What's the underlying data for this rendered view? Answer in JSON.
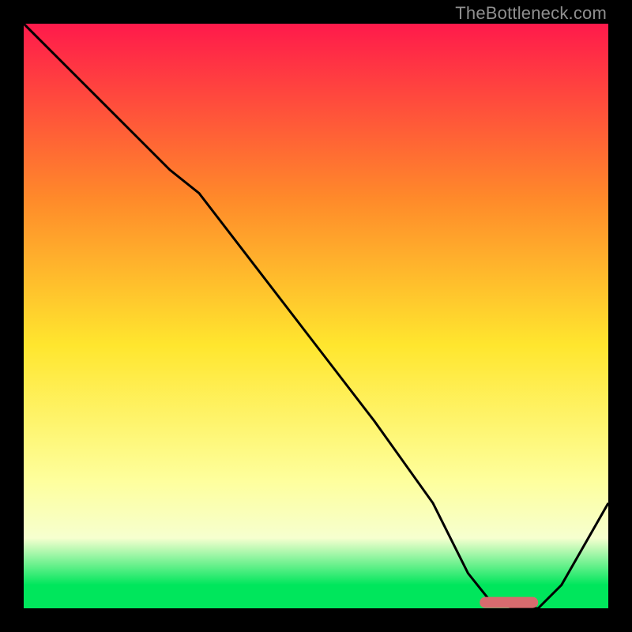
{
  "watermark": "TheBottleneck.com",
  "colors": {
    "red_top": "#ff1a4b",
    "orange": "#ff8a2a",
    "yellow": "#ffe62e",
    "pale_yellow": "#feff9c",
    "cream": "#f6ffcf",
    "green": "#00e65c",
    "curve": "#000000",
    "marker": "#d86b6e",
    "frame": "#000000"
  },
  "chart_data": {
    "type": "line",
    "title": "",
    "xlabel": "",
    "ylabel": "",
    "xlim": [
      0,
      100
    ],
    "ylim": [
      0,
      100
    ],
    "series": [
      {
        "name": "bottleneck-curve",
        "x": [
          0,
          10,
          20,
          25,
          30,
          40,
          50,
          60,
          70,
          76,
          80,
          84,
          88,
          92,
          100
        ],
        "y": [
          100,
          90,
          80,
          75,
          71,
          58,
          45,
          32,
          18,
          6,
          1,
          0,
          0,
          4,
          18
        ]
      }
    ],
    "marker": {
      "name": "optimal-range",
      "x_start": 78,
      "x_end": 88,
      "y": 1
    },
    "gradient_bands_pct_from_top": {
      "red": 0,
      "yellow_peak": 55,
      "pale_yellow": 78,
      "cream": 88,
      "green": 96
    }
  }
}
